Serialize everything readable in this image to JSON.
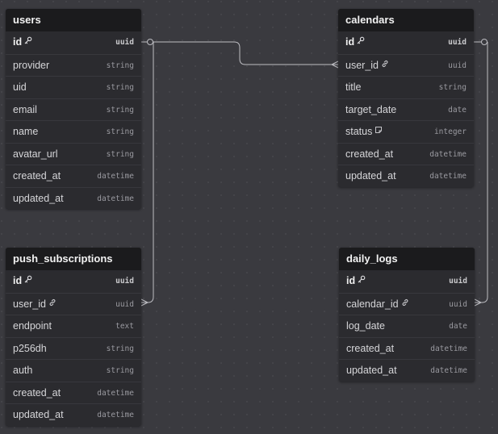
{
  "tables": [
    {
      "name": "users",
      "fields": [
        {
          "name": "id",
          "type": "uuid",
          "pk": true,
          "icon": "key-icon"
        },
        {
          "name": "provider",
          "type": "string"
        },
        {
          "name": "uid",
          "type": "string"
        },
        {
          "name": "email",
          "type": "string"
        },
        {
          "name": "name",
          "type": "string"
        },
        {
          "name": "avatar_url",
          "type": "string"
        },
        {
          "name": "created_at",
          "type": "datetime"
        },
        {
          "name": "updated_at",
          "type": "datetime"
        }
      ]
    },
    {
      "name": "calendars",
      "fields": [
        {
          "name": "id",
          "type": "uuid",
          "pk": true,
          "icon": "key-icon"
        },
        {
          "name": "user_id",
          "type": "uuid",
          "icon": "link-icon"
        },
        {
          "name": "title",
          "type": "string"
        },
        {
          "name": "target_date",
          "type": "date"
        },
        {
          "name": "status",
          "type": "integer",
          "icon": "note-icon"
        },
        {
          "name": "created_at",
          "type": "datetime"
        },
        {
          "name": "updated_at",
          "type": "datetime"
        }
      ]
    },
    {
      "name": "push_subscriptions",
      "fields": [
        {
          "name": "id",
          "type": "uuid",
          "pk": true,
          "icon": "key-icon"
        },
        {
          "name": "user_id",
          "type": "uuid",
          "icon": "link-icon"
        },
        {
          "name": "endpoint",
          "type": "text"
        },
        {
          "name": "p256dh",
          "type": "string"
        },
        {
          "name": "auth",
          "type": "string"
        },
        {
          "name": "created_at",
          "type": "datetime"
        },
        {
          "name": "updated_at",
          "type": "datetime"
        }
      ]
    },
    {
      "name": "daily_logs",
      "fields": [
        {
          "name": "id",
          "type": "uuid",
          "pk": true,
          "icon": "key-icon"
        },
        {
          "name": "calendar_id",
          "type": "uuid",
          "icon": "link-icon"
        },
        {
          "name": "log_date",
          "type": "date"
        },
        {
          "name": "created_at",
          "type": "datetime"
        },
        {
          "name": "updated_at",
          "type": "datetime"
        }
      ]
    }
  ],
  "relationships": [
    {
      "from": "users.id",
      "to": "calendars.user_id",
      "type": "one-to-many"
    },
    {
      "from": "users.id",
      "to": "push_subscriptions.user_id",
      "type": "one-to-many"
    },
    {
      "from": "calendars.id",
      "to": "daily_logs.calendar_id",
      "type": "one-to-many"
    }
  ],
  "colors": {
    "canvas": "#3a3a3f",
    "dots": "#4a4a50",
    "table_body": "#2b2b2f",
    "table_header": "#1b1b1d",
    "link_line": "#bdbdc2"
  }
}
